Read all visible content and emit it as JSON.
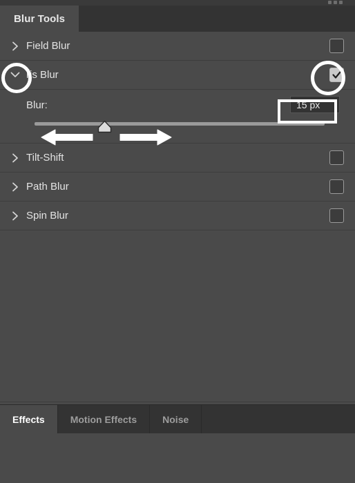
{
  "panel": {
    "tab_label": "Blur Tools",
    "overflow_icon": "overflow-dots-icon"
  },
  "tools": [
    {
      "name": "Field Blur",
      "expanded": false,
      "checked": false,
      "chevron": "chevron-right-icon"
    },
    {
      "name": "Iris Blur",
      "display_name": "ris Blur",
      "expanded": true,
      "checked": true,
      "chevron": "chevron-down-icon",
      "controls": {
        "blur_label": "Blur:",
        "blur_value": "15 px",
        "blur_slider_percent": 22
      }
    },
    {
      "name": "Tilt-Shift",
      "expanded": false,
      "checked": false,
      "chevron": "chevron-right-icon"
    },
    {
      "name": "Path Blur",
      "expanded": false,
      "checked": false,
      "chevron": "chevron-right-icon"
    },
    {
      "name": "Spin Blur",
      "expanded": false,
      "checked": false,
      "chevron": "chevron-right-icon"
    }
  ],
  "bottom_tabs": [
    {
      "label": "Effects",
      "active": true
    },
    {
      "label": "Motion Effects",
      "active": false
    },
    {
      "label": "Noise",
      "active": false
    }
  ],
  "annotations": {
    "circle_chevron": "highlight-circle-iris-chevron",
    "circle_checkbox": "highlight-circle-iris-checkbox",
    "rect_value": "highlight-rect-blur-value",
    "arrow_left": "annotation-arrow-left",
    "arrow_right": "annotation-arrow-right"
  },
  "colors": {
    "panel_bg": "#4a4a4a",
    "tabbar_bg": "#333333",
    "divider": "#3d3d3d",
    "text": "#e3e3e3",
    "text_dim": "#9d9d9d",
    "annotation": "#ffffff",
    "track": "#9a9a9a"
  }
}
